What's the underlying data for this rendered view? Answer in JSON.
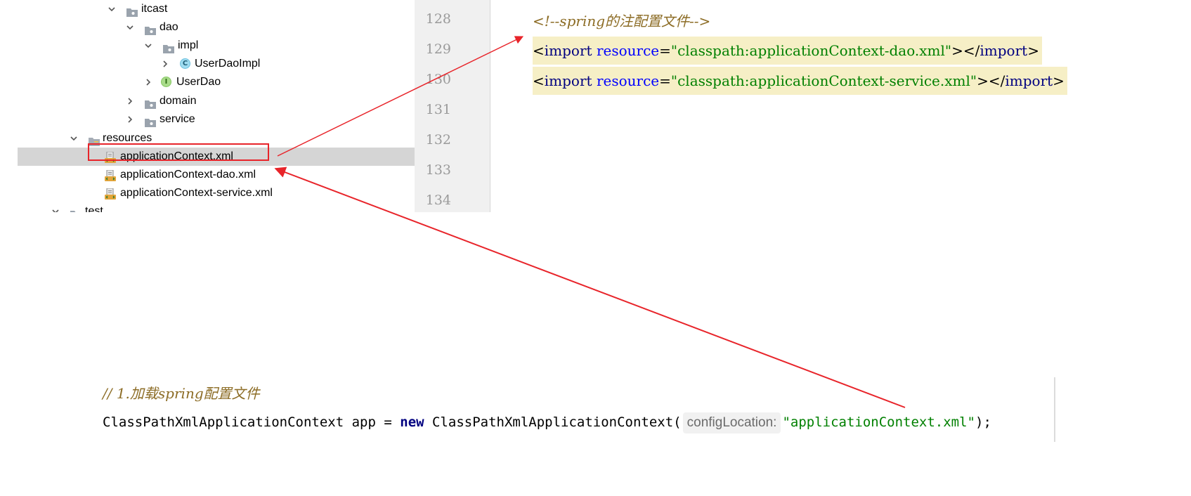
{
  "project_tree": {
    "items": [
      {
        "label": "itcast",
        "icon": "package-folder-icon",
        "expanded": true
      },
      {
        "label": "dao",
        "icon": "package-folder-icon",
        "expanded": true
      },
      {
        "label": "impl",
        "icon": "package-folder-icon",
        "expanded": true
      },
      {
        "label": "UserDaoImpl",
        "icon": "class-icon",
        "icon_text": "C",
        "expanded": false
      },
      {
        "label": "UserDao",
        "icon": "interface-icon",
        "icon_text": "I",
        "expanded": false
      },
      {
        "label": "domain",
        "icon": "package-folder-icon",
        "expanded": false
      },
      {
        "label": "service",
        "icon": "package-folder-icon",
        "expanded": false
      },
      {
        "label": "resources",
        "icon": "resources-folder-icon",
        "expanded": true
      },
      {
        "label": "applicationContext.xml",
        "icon": "xml-file-icon",
        "selected": true
      },
      {
        "label": "applicationContext-dao.xml",
        "icon": "xml-file-icon"
      },
      {
        "label": "applicationContext-service.xml",
        "icon": "xml-file-icon"
      },
      {
        "label": "test",
        "icon": "test-folder-icon",
        "expanded": true
      }
    ]
  },
  "xml_editor": {
    "line_numbers": [
      "128",
      "129",
      "130",
      "131",
      "132",
      "133",
      "134"
    ],
    "comment": "<!--spring的注配置文件-->",
    "imports": [
      {
        "open": "<",
        "tag": "import",
        "attr": "resource",
        "eq": "=",
        "value": "\"classpath:applicationContext-dao.xml\"",
        "mid": "></",
        "close_tag": "import",
        "end": ">"
      },
      {
        "open": "<",
        "tag": "import",
        "attr": "resource",
        "eq": "=",
        "value": "\"classpath:applicationContext-service.xml\"",
        "mid": "></",
        "close_tag": "import",
        "end": ">"
      }
    ]
  },
  "java_snippet": {
    "comment": "// 1.加载spring配置文件",
    "type_name": "ClassPathXmlApplicationContext",
    "var_name": " app = ",
    "new_kw": "new",
    "ctor_name": " ClassPathXmlApplicationContext(",
    "param_hint": "configLocation:",
    "arg_value": "\"applicationContext.xml\"",
    "tail": ");"
  },
  "colors": {
    "annotation_red": "#e8242a",
    "selection_gray": "#d5d5d5",
    "import_highlight": "#f6efc6",
    "string_green": "#008000",
    "keyword_navy": "#000080",
    "attr_blue": "#0000ff",
    "comment_brown": "#8c6c25"
  }
}
